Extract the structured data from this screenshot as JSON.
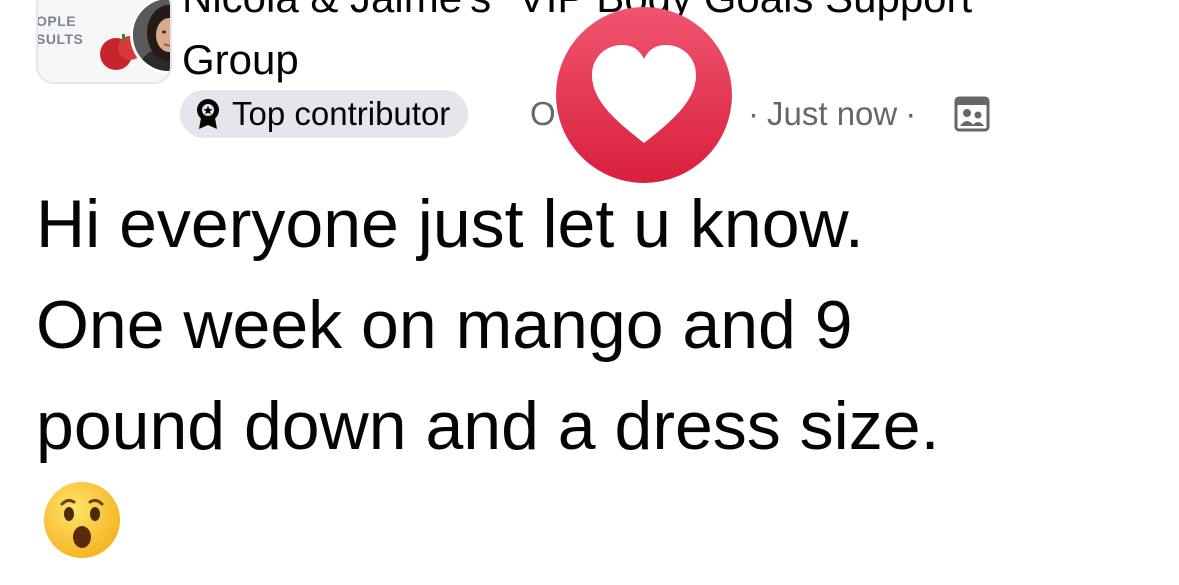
{
  "post": {
    "group_name_line1": "Nicola & Jaime's \"VIP Body Goals Support",
    "group_name_line2": "Group",
    "group_logo_text_1": "OPLE",
    "group_logo_text_2": "SULTS",
    "badge_label": "Top contributor",
    "author_stub": "O",
    "time_label": "Just now",
    "body_lines": [
      "Hi everyone just let u know.",
      "One week on mango and 9",
      "pound down and a dress size."
    ],
    "emoji_name": "astonished-face",
    "privacy_icon": "group-members-icon"
  },
  "reaction": {
    "type": "love-heart",
    "color_top": "#f0566f",
    "color_bottom": "#d81f3e"
  }
}
